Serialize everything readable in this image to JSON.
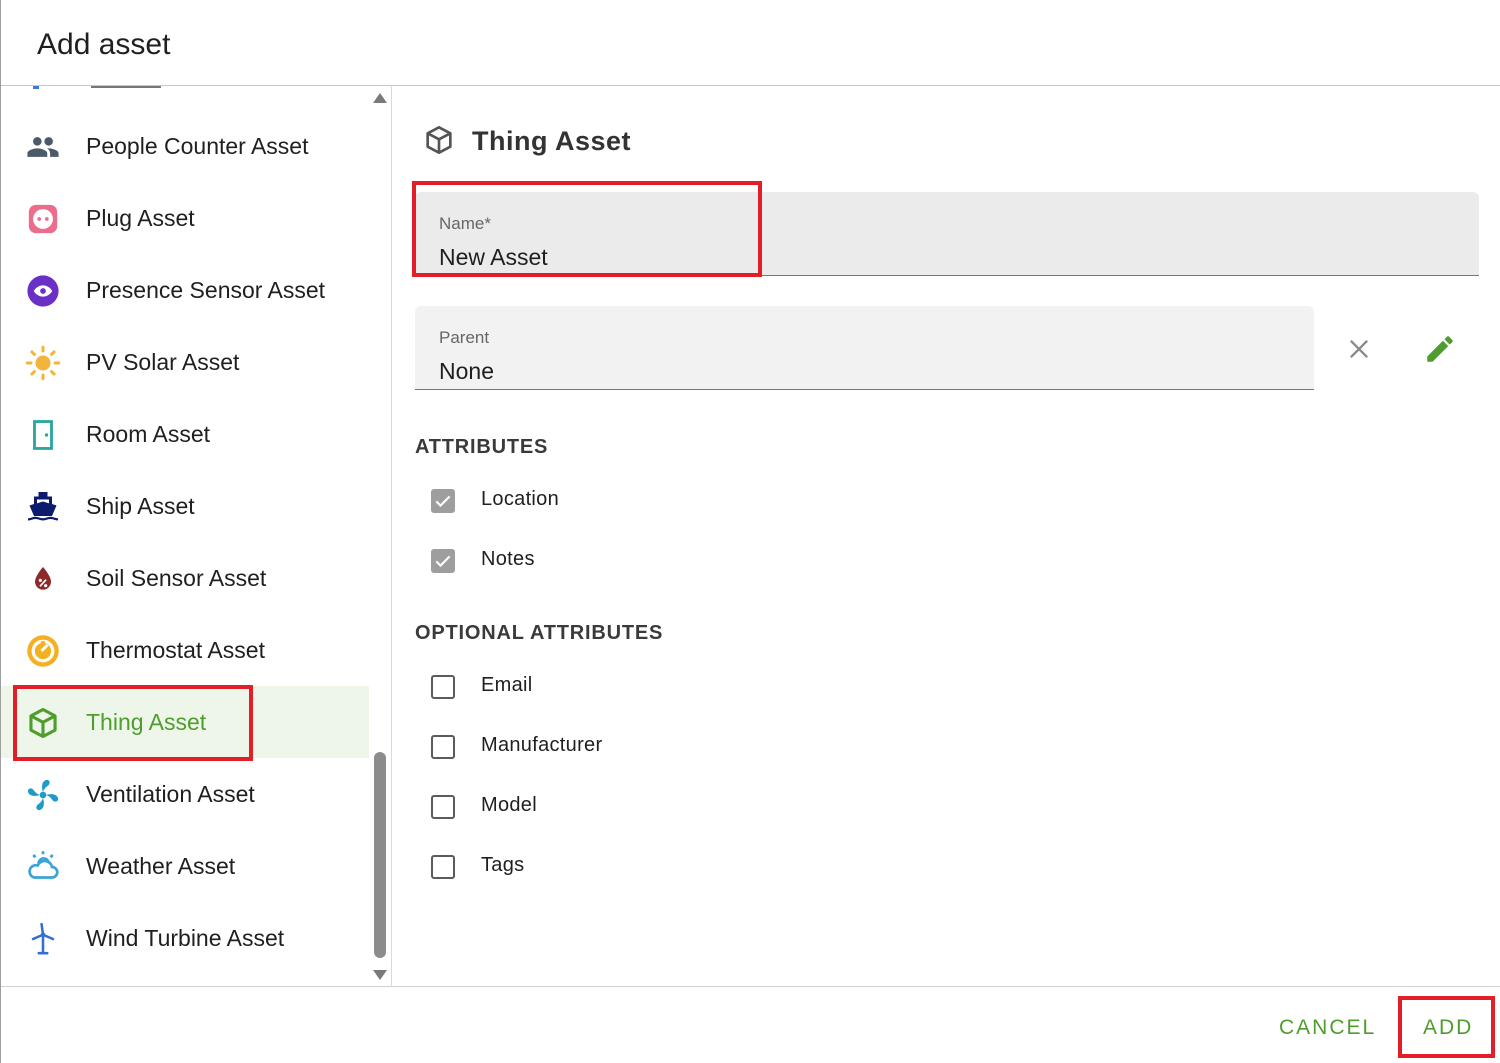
{
  "dialog": {
    "title": "Add asset"
  },
  "asset_list": {
    "items": [
      {
        "label": "People Counter Asset",
        "icon": "people-icon",
        "color": "#4a5a6a"
      },
      {
        "label": "Plug Asset",
        "icon": "plug-icon",
        "color": "#ec6c8c"
      },
      {
        "label": "Presence Sensor Asset",
        "icon": "eye-icon",
        "color": "#6a2fc4"
      },
      {
        "label": "PV Solar Asset",
        "icon": "sun-icon",
        "color": "#f2b43a"
      },
      {
        "label": "Room Asset",
        "icon": "door-icon",
        "color": "#2aa6a0"
      },
      {
        "label": "Ship Asset",
        "icon": "ship-icon",
        "color": "#0c1b6e"
      },
      {
        "label": "Soil Sensor Asset",
        "icon": "water-percent-icon",
        "color": "#8c2a2a"
      },
      {
        "label": "Thermostat Asset",
        "icon": "thermostat-icon",
        "color": "#f5b021"
      },
      {
        "label": "Thing Asset",
        "icon": "cube-icon",
        "color": "#4e9d2d",
        "selected": true
      },
      {
        "label": "Ventilation Asset",
        "icon": "fan-icon",
        "color": "#1e9bc8"
      },
      {
        "label": "Weather Asset",
        "icon": "weather-icon",
        "color": "#3aa4d8"
      },
      {
        "label": "Wind Turbine Asset",
        "icon": "wind-turbine-icon",
        "color": "#2f6fd6"
      }
    ]
  },
  "detail": {
    "title": "Thing Asset",
    "name_field": {
      "label": "Name*",
      "value": "New Asset"
    },
    "parent_field": {
      "label": "Parent",
      "value": "None"
    },
    "attributes_heading": "ATTRIBUTES",
    "attributes": [
      {
        "label": "Location",
        "checked": true
      },
      {
        "label": "Notes",
        "checked": true
      }
    ],
    "optional_heading": "OPTIONAL ATTRIBUTES",
    "optional_attributes": [
      {
        "label": "Email",
        "checked": false
      },
      {
        "label": "Manufacturer",
        "checked": false
      },
      {
        "label": "Model",
        "checked": false
      },
      {
        "label": "Tags",
        "checked": false
      }
    ]
  },
  "actions": {
    "cancel_label": "CANCEL",
    "add_label": "ADD"
  },
  "colors": {
    "accent": "#4e9d2d",
    "highlight": "#e21f26",
    "selected_bg": "#eef6ea"
  }
}
